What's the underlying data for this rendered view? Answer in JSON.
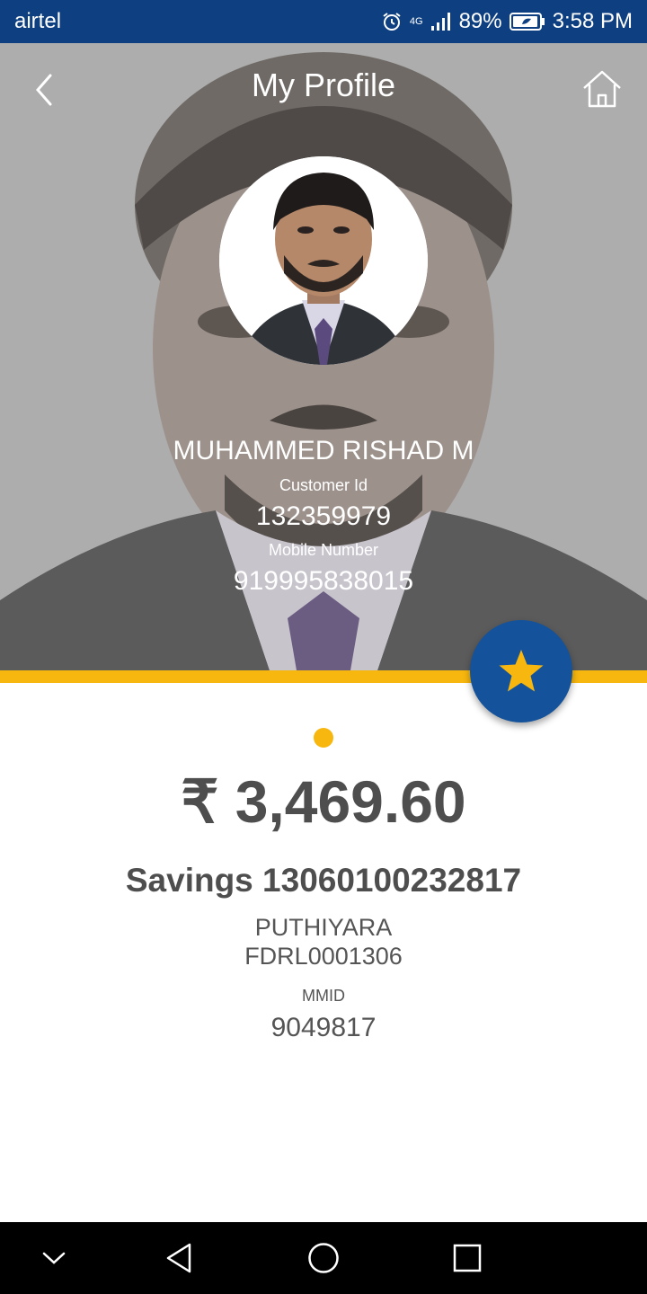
{
  "status_bar": {
    "carrier": "airtel",
    "network": "4G",
    "battery": "89%",
    "time": "3:58 PM",
    "icons": [
      "alarm-icon",
      "signal-icon",
      "battery-icon"
    ]
  },
  "header": {
    "title": "My Profile",
    "back_icon": "chevron-left-icon",
    "home_icon": "home-icon"
  },
  "profile": {
    "name": "MUHAMMED RISHAD M",
    "customer_id_label": "Customer Id",
    "customer_id": "132359979",
    "mobile_label": "Mobile Number",
    "mobile": "919995838015"
  },
  "favorite_icon": "star-icon",
  "account": {
    "balance": "₹ 3,469.60",
    "account_title": "Savings 13060100232817",
    "branch": "PUTHIYARA",
    "ifsc": "FDRL0001306",
    "mmid_label": "MMID",
    "mmid": "9049817"
  },
  "nav_bar": {
    "icons": [
      "collapse-icon",
      "back-triangle-icon",
      "home-circle-icon",
      "recents-square-icon"
    ]
  },
  "colors": {
    "status_bar": "#0e3f80",
    "accent": "#f7b70f",
    "fab": "#14539c",
    "text_dark": "#4e4e4e"
  }
}
